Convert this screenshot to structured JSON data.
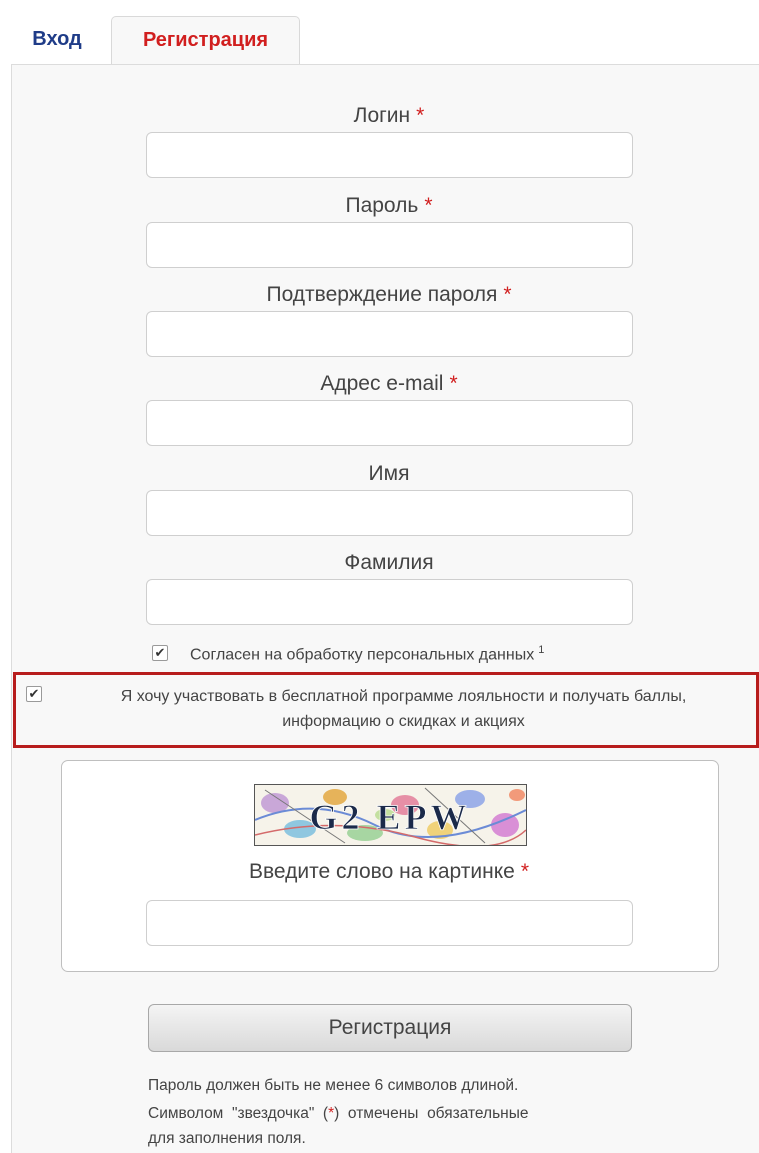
{
  "tabs": {
    "login": "Вход",
    "register": "Регистрация"
  },
  "form": {
    "required_mark": "*",
    "fields": [
      {
        "label": "Логин",
        "required": true,
        "value": ""
      },
      {
        "label": "Пароль",
        "required": true,
        "value": ""
      },
      {
        "label": "Подтверждение пароля",
        "required": true,
        "value": ""
      },
      {
        "label": "Адрес e-mail",
        "required": true,
        "value": ""
      },
      {
        "label": "Имя",
        "required": false,
        "value": ""
      },
      {
        "label": "Фамилия",
        "required": false,
        "value": ""
      }
    ],
    "consent": {
      "label": "Согласен на обработку персональных данных",
      "footnote": "1",
      "checked": true
    },
    "loyalty": {
      "line1": "Я хочу участвовать в бесплатной программе лояльности и получать баллы,",
      "line2": "информацию о скидках и акциях",
      "checked": true
    },
    "captcha": {
      "image_text": "G2 EPW",
      "label": "Введите слово на картинке",
      "value": ""
    },
    "submit_label": "Регистрация",
    "notes": {
      "line1": "Пароль должен быть не менее 6 символов длиной.",
      "line2_pre": "Символом  \"звездочка\"  (",
      "line2_star": "*",
      "line2_post": ")  отмечены  обязательные",
      "line3": "для заполнения поля."
    }
  },
  "colors": {
    "accent_red": "#d11f1f",
    "tab_blue": "#1f3c88",
    "highlight_border": "#b71c1c"
  }
}
